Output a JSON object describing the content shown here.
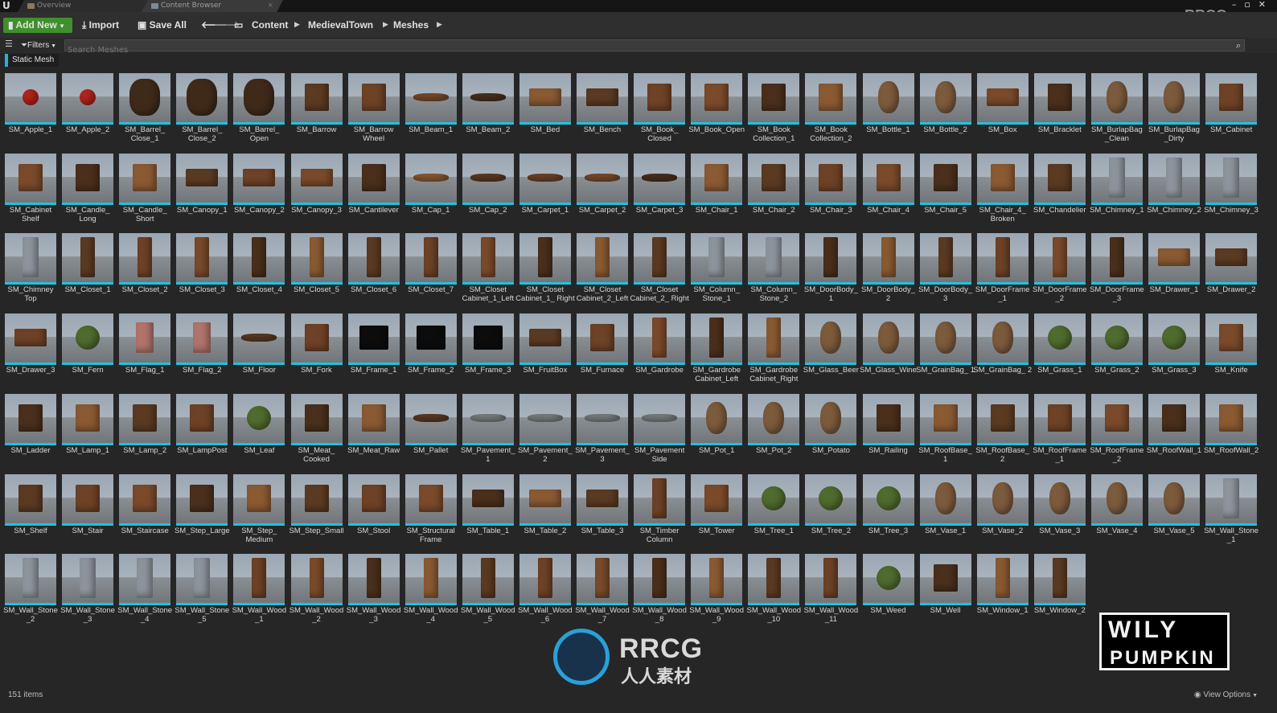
{
  "tabs": [
    {
      "label": "Overview"
    },
    {
      "label": "Content Browser"
    }
  ],
  "watermark_top": "RRCG.cn",
  "toolbar": {
    "add_new": "Add New",
    "import": "Import",
    "save_all": "Save All",
    "breadcrumb": [
      "Content",
      "MedievalTown",
      "Meshes"
    ]
  },
  "filters": {
    "label": "Filters",
    "search_placeholder": "Search Meshes",
    "active_chip": "Static Mesh"
  },
  "assets": [
    [
      "SM_Apple_1",
      "SM_Apple_2",
      "SM_Barrel_ Close_1",
      "SM_Barrel_ Close_2",
      "SM_Barrel_ Open",
      "SM_Barrow",
      "SM_Barrow Wheel",
      "SM_Beam_1",
      "SM_Beam_2",
      "SM_Bed",
      "SM_Bench",
      "SM_Book_ Closed",
      "SM_Book_Open",
      "SM_Book Collection_1",
      "SM_Book Collection_2",
      "SM_Bottle_1",
      "SM_Bottle_2",
      "SM_Box",
      "SM_Bracklet",
      "SM_BurlapBag _Clean",
      "SM_BurlapBag _Dirty",
      "SM_Cabinet"
    ],
    [
      "SM_Cabinet Shelf",
      "SM_Candle_ Long",
      "SM_Candle_ Short",
      "SM_Canopy_1",
      "SM_Canopy_2",
      "SM_Canopy_3",
      "SM_Cantilever",
      "SM_Cap_1",
      "SM_Cap_2",
      "SM_Carpet_1",
      "SM_Carpet_2",
      "SM_Carpet_3",
      "SM_Chair_1",
      "SM_Chair_2",
      "SM_Chair_3",
      "SM_Chair_4",
      "SM_Chair_5",
      "SM_Chair_4_ Broken",
      "SM_Chandelier",
      "SM_Chimney_1",
      "SM_Chimney_2",
      "SM_Chimney_3"
    ],
    [
      "SM_Chimney Top",
      "SM_Closet_1",
      "SM_Closet_2",
      "SM_Closet_3",
      "SM_Closet_4",
      "SM_Closet_5",
      "SM_Closet_6",
      "SM_Closet_7",
      "SM_Closet Cabinet_1_Left",
      "SM_Closet Cabinet_1_ Right",
      "SM_Closet Cabinet_2_Left",
      "SM_Closet Cabinet_2_ Right",
      "SM_Column_ Stone_1",
      "SM_Column_ Stone_2",
      "SM_DoorBody_ 1",
      "SM_DoorBody_ 2",
      "SM_DoorBody_ 3",
      "SM_DoorFrame _1",
      "SM_DoorFrame _2",
      "SM_DoorFrame _3",
      "SM_Drawer_1",
      "SM_Drawer_2"
    ],
    [
      "SM_Drawer_3",
      "SM_Fern",
      "SM_Flag_1",
      "SM_Flag_2",
      "SM_Floor",
      "SM_Fork",
      "SM_Frame_1",
      "SM_Frame_2",
      "SM_Frame_3",
      "SM_FruitBox",
      "SM_Furnace",
      "SM_Gardrobe",
      "SM_Gardrobe Cabinet_Left",
      "SM_Gardrobe Cabinet_Right",
      "SM_Glass_Beer",
      "SM_Glass_Wine",
      "SM_GrainBag_ 1",
      "SM_GrainBag_ 2",
      "SM_Grass_1",
      "SM_Grass_2",
      "SM_Grass_3",
      "SM_Knife"
    ],
    [
      "SM_Ladder",
      "SM_Lamp_1",
      "SM_Lamp_2",
      "SM_LampPost",
      "SM_Leaf",
      "SM_Meat_ Cooked",
      "SM_Meat_Raw",
      "SM_Pallet",
      "SM_Pavement_ 1",
      "SM_Pavement_ 2",
      "SM_Pavement_ 3",
      "SM_Pavement Side",
      "SM_Pot_1",
      "SM_Pot_2",
      "SM_Potato",
      "SM_Railing",
      "SM_RoofBase_ 1",
      "SM_RoofBase_ 2",
      "SM_RoofFrame _1",
      "SM_RoofFrame _2",
      "SM_RoofWall_1",
      "SM_RoofWall_2"
    ],
    [
      "SM_Shelf",
      "SM_Stair",
      "SM_Staircase",
      "SM_Step_Large",
      "SM_Step_ Medium",
      "SM_Step_Small",
      "SM_Stool",
      "SM_Structural Frame",
      "SM_Table_1",
      "SM_Table_2",
      "SM_Table_3",
      "SM_Timber Column",
      "SM_Tower",
      "SM_Tree_1",
      "SM_Tree_2",
      "SM_Tree_3",
      "SM_Vase_1",
      "SM_Vase_2",
      "SM_Vase_3",
      "SM_Vase_4",
      "SM_Vase_5",
      "SM_Wall_Stone _1"
    ],
    [
      "SM_Wall_Stone _2",
      "SM_Wall_Stone _3",
      "SM_Wall_Stone _4",
      "SM_Wall_Stone _5",
      "SM_Wall_Wood _1",
      "SM_Wall_Wood _2",
      "SM_Wall_Wood _3",
      "SM_Wall_Wood _4",
      "SM_Wall_Wood _5",
      "SM_Wall_Wood _6",
      "SM_Wall_Wood _7",
      "SM_Wall_Wood _8",
      "SM_Wall_Wood _9",
      "SM_Wall_Wood _10",
      "SM_Wall_Wood _11",
      "SM_Weed",
      "SM_Well",
      "SM_Window_1",
      "SM_Window_2"
    ]
  ],
  "status": {
    "item_count": "151 items",
    "view_options": "View Options"
  },
  "watermark_logo": {
    "latin": "RRCG",
    "cn": "人人素材"
  },
  "brand_logo": {
    "line1": "WILY",
    "line2": "PUMPKIN"
  },
  "colors": {
    "accent": "#1fc3dd",
    "add_new_green": "#3f8f2c"
  }
}
